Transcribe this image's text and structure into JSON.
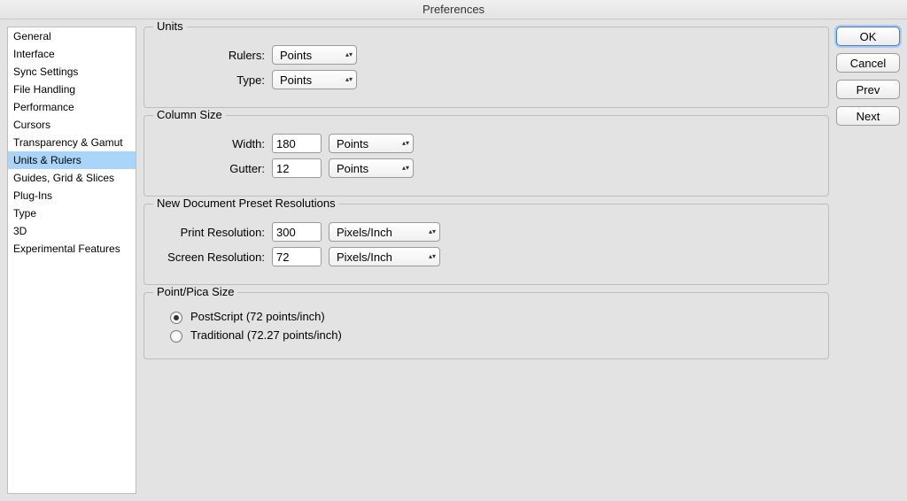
{
  "title": "Preferences",
  "sidebar": {
    "items": [
      {
        "label": "General"
      },
      {
        "label": "Interface"
      },
      {
        "label": "Sync Settings"
      },
      {
        "label": "File Handling"
      },
      {
        "label": "Performance"
      },
      {
        "label": "Cursors"
      },
      {
        "label": "Transparency & Gamut"
      },
      {
        "label": "Units & Rulers"
      },
      {
        "label": "Guides, Grid & Slices"
      },
      {
        "label": "Plug-Ins"
      },
      {
        "label": "Type"
      },
      {
        "label": "3D"
      },
      {
        "label": "Experimental Features"
      }
    ],
    "selected_index": 7
  },
  "groups": {
    "units": {
      "title": "Units",
      "rulers_label": "Rulers:",
      "rulers_value": "Points",
      "type_label": "Type:",
      "type_value": "Points"
    },
    "column": {
      "title": "Column Size",
      "width_label": "Width:",
      "width_value": "180",
      "width_unit": "Points",
      "gutter_label": "Gutter:",
      "gutter_value": "12",
      "gutter_unit": "Points"
    },
    "resolutions": {
      "title": "New Document Preset Resolutions",
      "print_label": "Print Resolution:",
      "print_value": "300",
      "print_unit": "Pixels/Inch",
      "screen_label": "Screen Resolution:",
      "screen_value": "72",
      "screen_unit": "Pixels/Inch"
    },
    "pointpica": {
      "title": "Point/Pica Size",
      "postscript_label": "PostScript (72 points/inch)",
      "traditional_label": "Traditional (72.27 points/inch)",
      "selected": "postscript"
    }
  },
  "buttons": {
    "ok": "OK",
    "cancel": "Cancel",
    "prev": "Prev",
    "next": "Next"
  }
}
